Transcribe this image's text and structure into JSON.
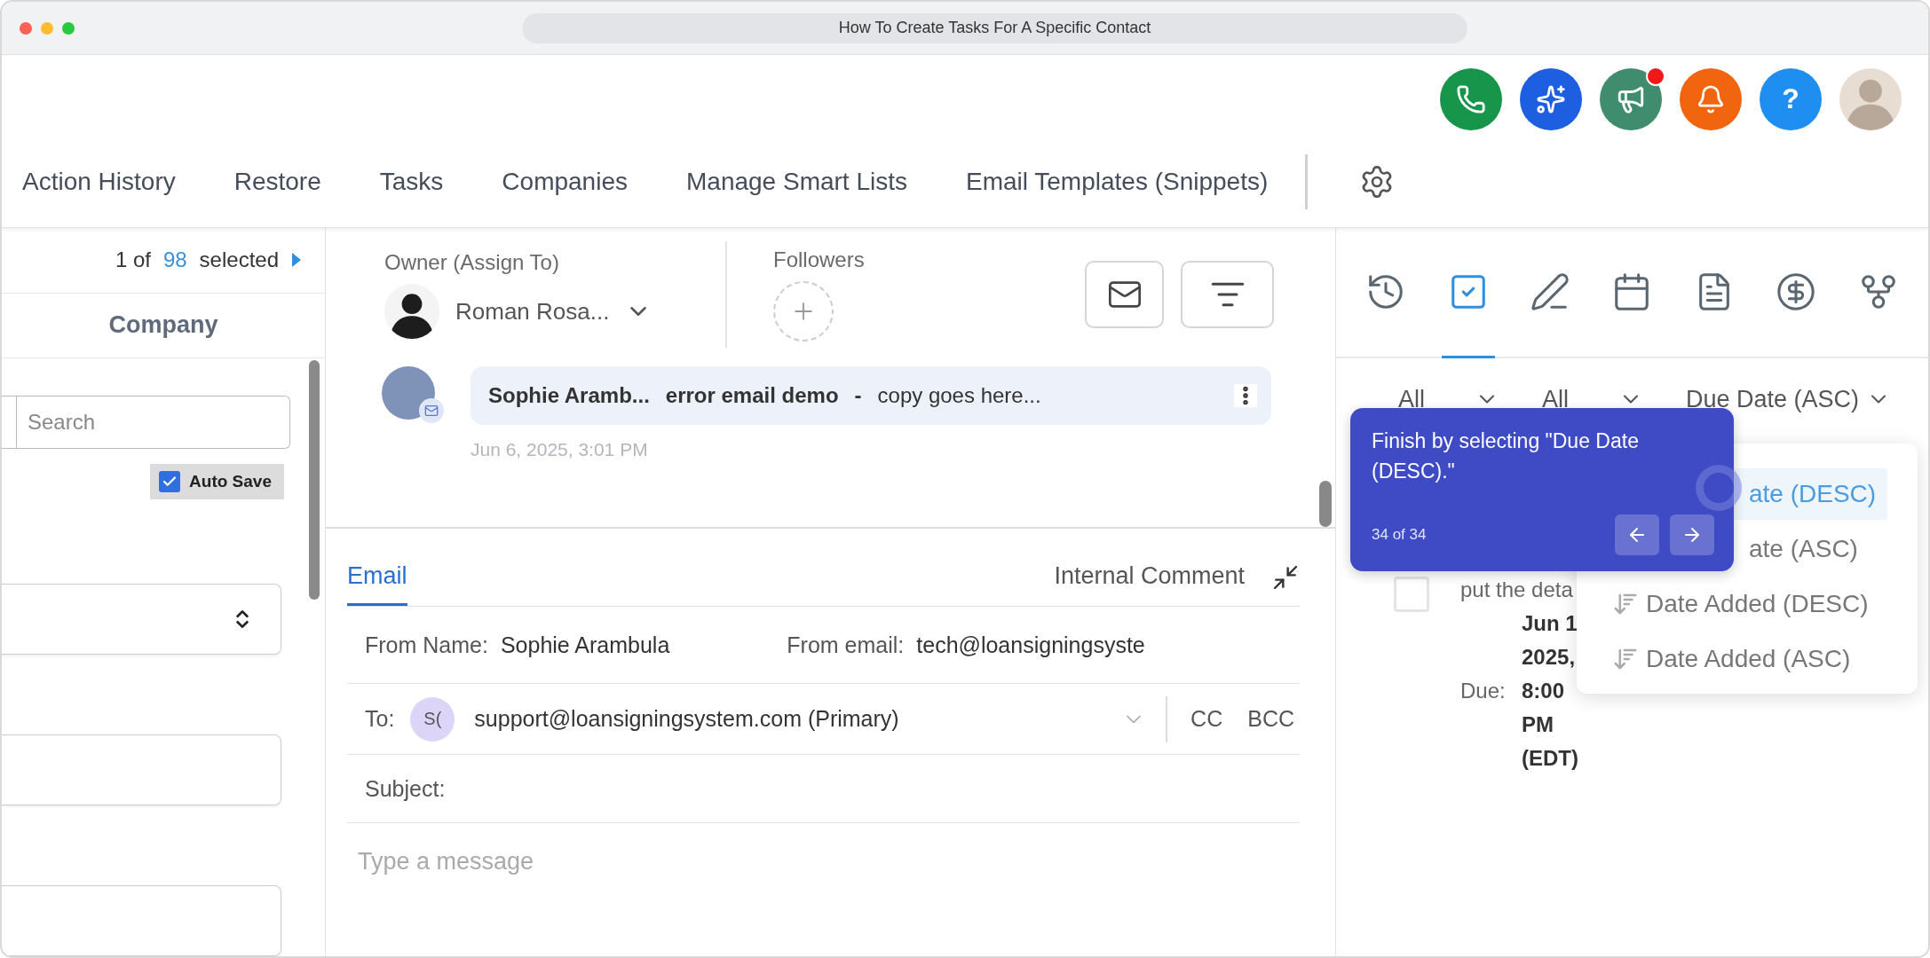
{
  "window": {
    "title": "How To Create Tasks For A Specific Contact"
  },
  "header_actions": [
    {
      "kind": "phone",
      "badge": false
    },
    {
      "kind": "assistant",
      "badge": false
    },
    {
      "kind": "announcements",
      "badge": true
    },
    {
      "kind": "notifications",
      "badge": false
    },
    {
      "kind": "help",
      "label": "?",
      "badge": false
    },
    {
      "kind": "avatar"
    }
  ],
  "nav": [
    "Action History",
    "Restore",
    "Tasks",
    "Companies",
    "Manage Smart Lists",
    "Email Templates (Snippets)"
  ],
  "list_panel": {
    "position": "1 of",
    "count": "98",
    "suffix": "selected",
    "column": "Company",
    "search": {
      "placeholder": "Search"
    },
    "auto_save": {
      "label": "Auto Save",
      "checked": true
    }
  },
  "conversation": {
    "owner_label": "Owner (Assign To)",
    "owner_name": "Roman Rosa...",
    "followers_label": "Followers",
    "message": {
      "sender": "Sophie Aramb...",
      "subject": "error email demo",
      "separator": "-",
      "preview": "copy goes here...",
      "time": "Jun 6, 2025, 3:01 PM"
    }
  },
  "composer": {
    "tabs": [
      {
        "label": "Email",
        "selected": true
      },
      {
        "label": "Internal Comment",
        "selected": false
      }
    ],
    "from_name_label": "From Name:",
    "from_name": "Sophie Arambula",
    "from_email_label": "From email:",
    "from_email": "tech@loansigningsyste",
    "to_label": "To:",
    "to_initials": "S(",
    "to": "support@loansigningsystem.com (Primary)",
    "cc": "CC",
    "bcc": "BCC",
    "subject_label": "Subject:",
    "message": {
      "placeholder": "Type a message"
    }
  },
  "side_panel": {
    "tabs": [
      {
        "kind": "history",
        "selected": false
      },
      {
        "kind": "tasks",
        "selected": true
      },
      {
        "kind": "notes",
        "selected": false
      },
      {
        "kind": "calendar",
        "selected": false
      },
      {
        "kind": "documents",
        "selected": false
      },
      {
        "kind": "payments",
        "selected": false
      },
      {
        "kind": "workflows",
        "selected": false
      }
    ],
    "filters": [
      "All",
      "All",
      "Due Date (ASC)"
    ],
    "task": {
      "checked": false,
      "text": "put the deta",
      "due_label": "Due:",
      "due_lines": [
        "Jun 1",
        "2025,",
        "8:00",
        "PM",
        "(EDT)"
      ]
    },
    "sort_menu": [
      {
        "label": "ate (DESC)",
        "selected": true,
        "icon": false
      },
      {
        "label": "ate (ASC)",
        "selected": false,
        "icon": false
      },
      {
        "label": "Date Added (DESC)",
        "selected": false,
        "icon": true
      },
      {
        "label": "Date Added (ASC)",
        "selected": false,
        "icon": true
      }
    ]
  },
  "tour": {
    "text": "Finish by selecting \"Due Date (DESC).\"",
    "step": "34 of 34"
  }
}
